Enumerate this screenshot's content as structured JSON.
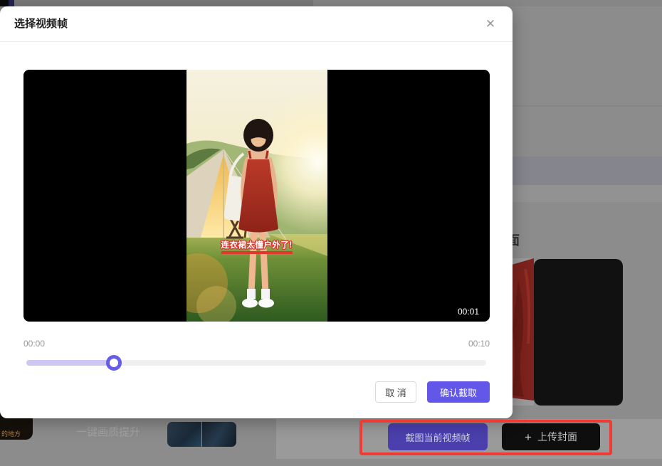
{
  "modal": {
    "title": "选择视频帧",
    "close_icon": "✕",
    "video": {
      "caption": "连衣裙太懂户外了!",
      "current_time_badge": "00:01"
    },
    "timeline": {
      "elapsed_label": "00:00",
      "duration_label": "00:10",
      "progress_percent": 19
    },
    "cancel_label": "取 消",
    "confirm_label": "确认截取"
  },
  "background": {
    "cover_label_partial": "面",
    "left_thumb_caption": "的地方",
    "enhance_text": "一键画质提升",
    "capture_button_label": "截图当前视频帧",
    "upload_plus": "+",
    "upload_button_label": "上传封面"
  },
  "colors": {
    "confirm_purple": "#6257e9",
    "slider_purple": "#675ce8",
    "caption_red": "#e0372e",
    "annotation_red": "#ee3b33",
    "dimmed_backdrop": "#8c8c8c"
  }
}
